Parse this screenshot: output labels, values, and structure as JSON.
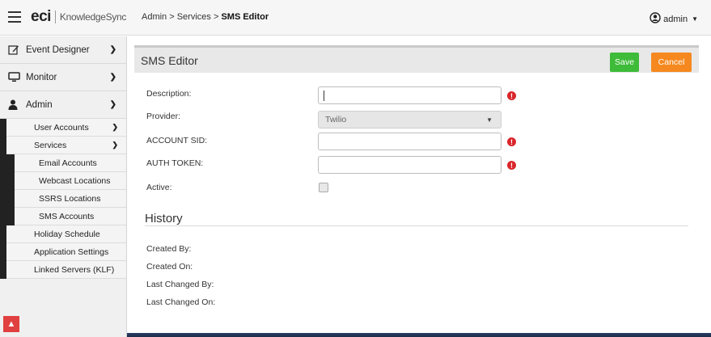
{
  "header": {
    "logo_mark": "eci",
    "logo_product": "KnowledgeSync",
    "breadcrumb_prefix": "Admin > Services > ",
    "breadcrumb_current": "SMS Editor",
    "user_name": "admin"
  },
  "sidebar": {
    "main": [
      {
        "label": "Event Designer",
        "icon": "edit-icon"
      },
      {
        "label": "Monitor",
        "icon": "monitor-icon"
      },
      {
        "label": "Admin",
        "icon": "user-icon"
      }
    ],
    "admin_items": {
      "user_accounts": "User Accounts",
      "services": "Services",
      "services_items": [
        "Email Accounts",
        "Webcast Locations",
        "SSRS Locations",
        "SMS Accounts"
      ],
      "holiday_schedule": "Holiday Schedule",
      "application_settings": "Application Settings",
      "linked_servers": "Linked Servers (KLF)"
    }
  },
  "editor": {
    "title": "SMS Editor",
    "save_label": "Save",
    "cancel_label": "Cancel",
    "fields": {
      "description_label": "Description:",
      "description_value": "",
      "provider_label": "Provider:",
      "provider_value": "Twilio",
      "account_sid_label": "ACCOUNT SID:",
      "account_sid_value": "",
      "auth_token_label": "AUTH TOKEN:",
      "auth_token_value": "",
      "active_label": "Active:"
    },
    "required_marker": "!",
    "history": {
      "title": "History",
      "created_by": "Created By:",
      "created_on": "Created On:",
      "last_changed_by": "Last Changed By:",
      "last_changed_on": "Last Changed On:"
    }
  },
  "colors": {
    "save": "#3fbb3a",
    "cancel": "#f5891f",
    "required": "#d9262c",
    "scroll_top": "#e04040"
  }
}
